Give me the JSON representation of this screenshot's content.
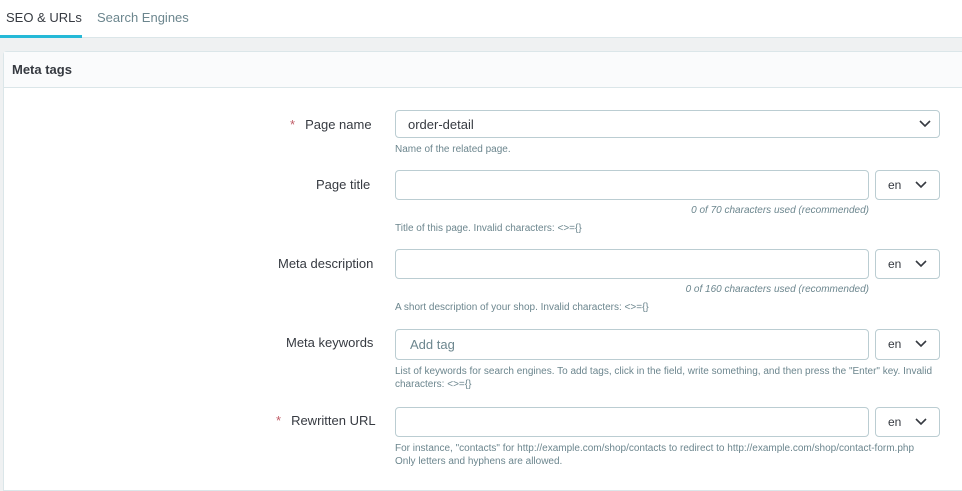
{
  "tabs": [
    {
      "label": "SEO & URLs",
      "active": true
    },
    {
      "label": "Search Engines",
      "active": false
    }
  ],
  "panel": {
    "title": "Meta tags"
  },
  "required_mark": "*",
  "fields": {
    "page_name": {
      "label": "Page name",
      "value": "order-detail",
      "help": "Name of the related page."
    },
    "page_title": {
      "label": "Page title",
      "value": "",
      "lang": "en",
      "counter": "0 of 70 characters used (recommended)",
      "help": "Title of this page. Invalid characters: <>={}"
    },
    "meta_description": {
      "label": "Meta description",
      "value": "",
      "lang": "en",
      "counter": "0 of 160 characters used (recommended)",
      "help": "A short description of your shop. Invalid characters: <>={}"
    },
    "meta_keywords": {
      "label": "Meta keywords",
      "placeholder": "Add tag",
      "lang": "en",
      "help_line1": "List of keywords for search engines. To add tags, click in the field, write something, and then press the \"Enter\" key. Invalid",
      "help_line2": "characters: <>={}"
    },
    "rewritten_url": {
      "label": "Rewritten URL",
      "value": "",
      "lang": "en",
      "help_line1": "For instance, \"contacts\" for http://example.com/shop/contacts to redirect to http://example.com/shop/contact-form.php",
      "help_line2": "Only letters and hyphens are allowed."
    }
  },
  "icons": {
    "select_arrow": "chevron-down-icon"
  },
  "colors": {
    "accent": "#25b9d7",
    "required": "#c05c67",
    "border": "#bbcdd2",
    "muted": "#6c868e"
  }
}
